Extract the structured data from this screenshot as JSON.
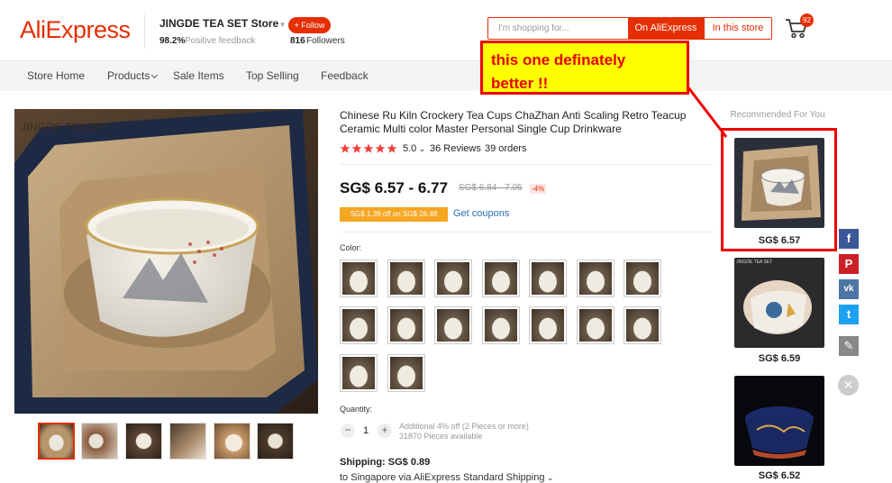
{
  "header": {
    "logo": "AliExpress",
    "store_name": "JINGDE TEA SET Store",
    "feedback_pct": "98.2%",
    "feedback_label": "Positive feedback",
    "follow_label": "+ Follow",
    "followers_count": "816",
    "followers_label": "Followers",
    "search_placeholder": "I'm shopping for...",
    "search_btn_ali": "On AliExpress",
    "search_btn_store": "In this store",
    "cart_count": "92"
  },
  "nav": {
    "items": [
      "Store Home",
      "Products",
      "Sale Items",
      "Top Selling",
      "Feedback"
    ]
  },
  "gallery": {
    "watermark": "JINGDE TEASET",
    "thumb_count": 6
  },
  "product": {
    "title": "Chinese Ru Kiln Crockery Tea Cups ChaZhan Anti Scaling Retro Teacup Ceramic Multi color Master Personal Single Cup Drinkware",
    "rating": "5.0",
    "rating_stars": 5,
    "reviews": "36 Reviews",
    "orders": "39 orders",
    "price": "SG$ 6.57 - 6.77",
    "old_price": "SG$ 6.84 - 7.05",
    "discount": "-4%",
    "coupon": "SG$ 1.39 off on SG$ 26.48",
    "get_coupons": "Get coupons",
    "color_label": "Color:",
    "swatch_count": 16,
    "quantity_label": "Quantity:",
    "quantity_minus": "−",
    "quantity_value": "1",
    "quantity_plus": "+",
    "quantity_note": "Additional 4% off (2 Pieces or more)",
    "pieces_available": "31870 Pieces available",
    "shipping": "Shipping: SG$ 0.89",
    "shipping_via": "to Singapore via AliExpress Standard Shipping"
  },
  "recommended": {
    "title": "Recommended For You",
    "items": [
      {
        "price": "SG$ 6.57",
        "brand_text": ""
      },
      {
        "price": "SG$ 6.59",
        "brand_text": "JINGDE TEA SET"
      },
      {
        "price": "SG$ 6.52",
        "brand_text": ""
      }
    ]
  },
  "social": [
    {
      "icon": "facebook-icon",
      "glyph": "f",
      "color": "#3b5998"
    },
    {
      "icon": "pinterest-icon",
      "glyph": "P",
      "color": "#cb2027"
    },
    {
      "icon": "vk-icon",
      "glyph": "vk",
      "color": "#4c75a3"
    },
    {
      "icon": "twitter-icon",
      "glyph": "t",
      "color": "#1da1f2"
    },
    {
      "icon": "edit-icon",
      "glyph": "✎",
      "color": "#888888"
    }
  ],
  "annotation": {
    "text_line1": "this one definately",
    "text_line2": "better !!"
  },
  "colors": {
    "brand": "#e62e04",
    "star": "#f33a3a",
    "link": "#2a6eb5",
    "coupon": "#f5a623",
    "annotation_fill": "#ffff00",
    "annotation_border": "#e00000"
  }
}
